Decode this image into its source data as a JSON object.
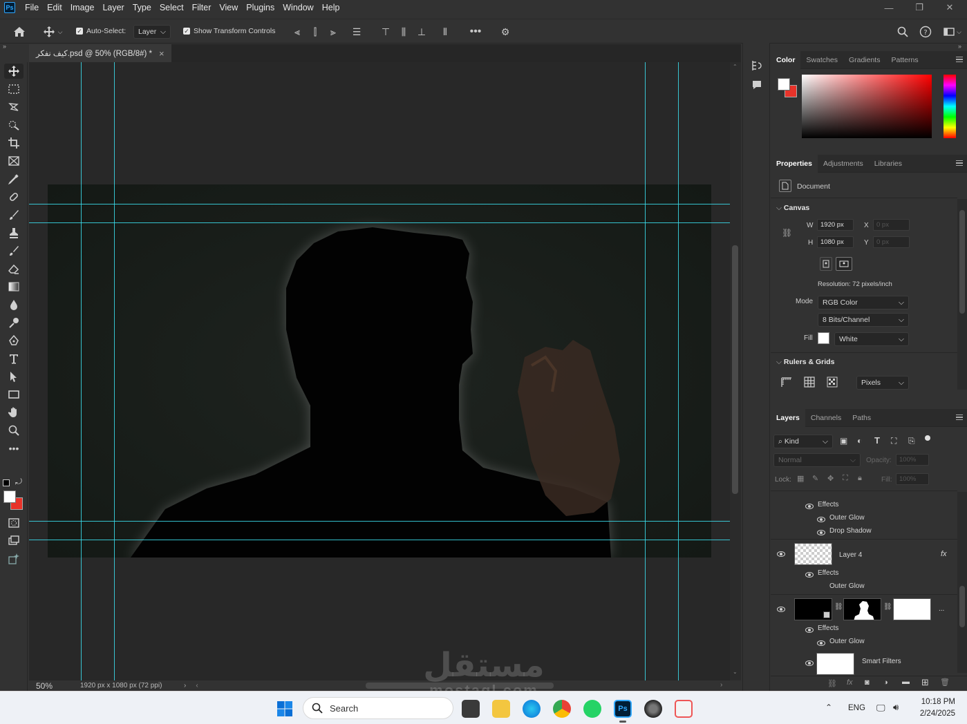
{
  "app": {
    "logo": "Ps"
  },
  "menu": [
    "File",
    "Edit",
    "Image",
    "Layer",
    "Type",
    "Select",
    "Filter",
    "View",
    "Plugins",
    "Window",
    "Help"
  ],
  "options": {
    "auto_select_label": "Auto-Select:",
    "auto_select_value": "Layer",
    "show_transform_label": "Show Transform Controls"
  },
  "document_tab": {
    "title": "كيف نفكر.psd @ 50% (RGB/8#) *",
    "close": "×"
  },
  "status": {
    "zoom": "50%",
    "info": "1920 px x 1080 px (72 ppi)"
  },
  "color_panel": {
    "tabs": [
      "Color",
      "Swatches",
      "Gradients",
      "Patterns"
    ],
    "active": "Color",
    "fg": "#ffffff",
    "bg": "#e8332a"
  },
  "properties": {
    "tabs": [
      "Properties",
      "Adjustments",
      "Libraries"
    ],
    "active": "Properties",
    "document_label": "Document",
    "canvas_section": "Canvas",
    "w_label": "W",
    "w_value": "1920 px",
    "h_label": "H",
    "h_value": "1080 px",
    "x_label": "X",
    "x_value": "0 px",
    "y_label": "Y",
    "y_value": "0 px",
    "resolution": "Resolution: 72 pixels/inch",
    "mode_label": "Mode",
    "mode_value": "RGB Color",
    "bits_value": "8 Bits/Channel",
    "fill_label": "Fill",
    "fill_value": "White",
    "rulers_section": "Rulers & Grids",
    "units_value": "Pixels"
  },
  "layers": {
    "tabs": [
      "Layers",
      "Channels",
      "Paths"
    ],
    "active": "Layers",
    "kind_value": "Kind",
    "blend_value": "Normal",
    "opacity_label": "Opacity:",
    "opacity_value": "100%",
    "lock_label": "Lock:",
    "fill_label": "Fill:",
    "fill_value": "100%",
    "rows": {
      "effects1": "Effects",
      "outer_glow1": "Outer Glow",
      "drop_shadow1": "Drop Shadow",
      "layer4": "Layer 4",
      "fx": "fx",
      "effects2": "Effects",
      "outer_glow2": "Outer Glow",
      "effects3": "Effects",
      "outer_glow3": "Outer Glow",
      "smart_filters": "Smart Filters",
      "more": "..."
    }
  },
  "taskbar": {
    "search_placeholder": "Search",
    "lang": "ENG",
    "time": "10:18 PM",
    "date": "2/24/2025"
  },
  "watermark": {
    "arabic": "مستقل",
    "latin": "mostaql.com"
  }
}
